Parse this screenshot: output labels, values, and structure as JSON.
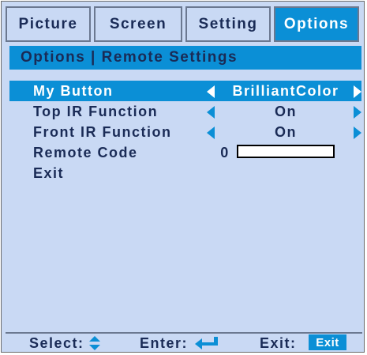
{
  "tabs": [
    {
      "label": "Picture",
      "active": false
    },
    {
      "label": "Screen",
      "active": false
    },
    {
      "label": "Setting",
      "active": false
    },
    {
      "label": "Options",
      "active": true
    }
  ],
  "breadcrumb": "Options | Remote Settings",
  "menu": {
    "my_button": {
      "label": "My Button",
      "value": "BrilliantColor"
    },
    "top_ir": {
      "label": "Top IR Function",
      "value": "On"
    },
    "front_ir": {
      "label": "Front IR Function",
      "value": "On"
    },
    "remote_code": {
      "label": "Remote Code",
      "value": "0"
    },
    "exit": {
      "label": "Exit"
    }
  },
  "footer": {
    "select_label": "Select:",
    "enter_label": "Enter:",
    "exit_label": "Exit:",
    "exit_badge": "Exit"
  },
  "colors": {
    "accent": "#0b8fd6",
    "panel": "#c9d9f4",
    "text": "#1a2b56"
  }
}
